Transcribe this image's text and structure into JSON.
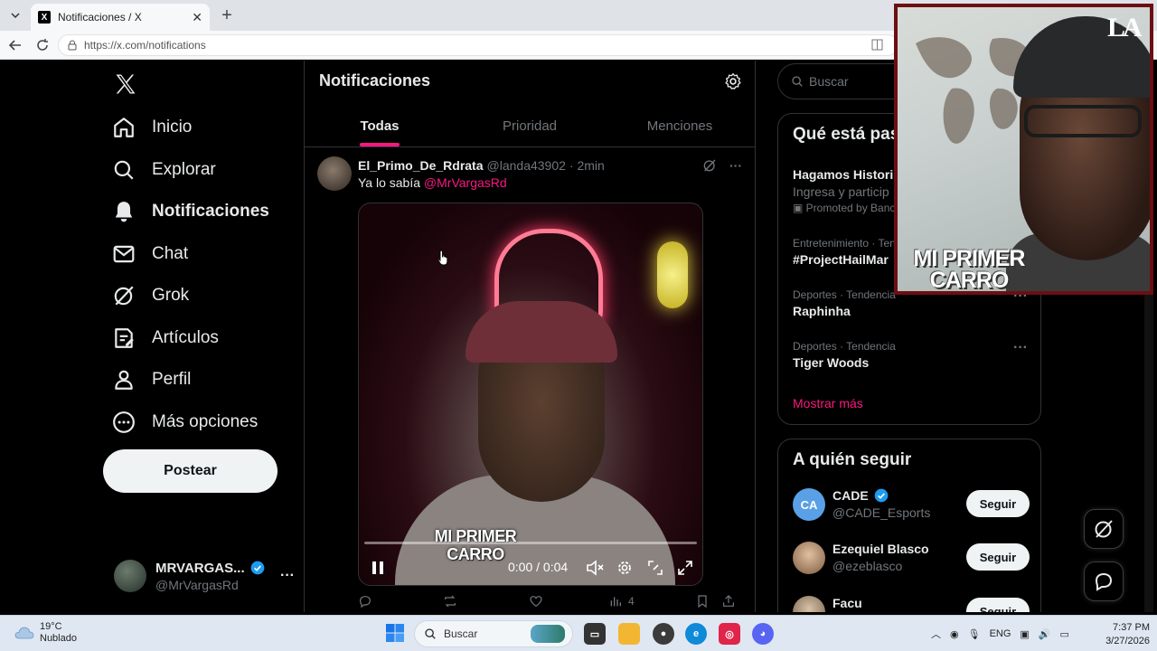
{
  "browser": {
    "tab_title": "Notificaciones / X",
    "url": "https://x.com/notifications"
  },
  "sidebar": {
    "items": [
      {
        "label": "Inicio",
        "icon": "home-icon",
        "active": false
      },
      {
        "label": "Explorar",
        "icon": "search-icon",
        "active": false
      },
      {
        "label": "Notificaciones",
        "icon": "bell-icon",
        "active": true
      },
      {
        "label": "Chat",
        "icon": "mail-icon",
        "active": false
      },
      {
        "label": "Grok",
        "icon": "grok-icon",
        "active": false
      },
      {
        "label": "Artículos",
        "icon": "article-icon",
        "active": false
      },
      {
        "label": "Perfil",
        "icon": "person-icon",
        "active": false
      },
      {
        "label": "Más opciones",
        "icon": "more-circle-icon",
        "active": false
      }
    ],
    "post_label": "Postear",
    "account": {
      "name": "MRVARGAS...",
      "handle": "@MrVargasRd"
    }
  },
  "main": {
    "title": "Notificaciones",
    "tabs": [
      "Todas",
      "Prioridad",
      "Menciones"
    ],
    "active_tab": "Todas",
    "tweet": {
      "name": "El_Primo_De_Rdrata",
      "handle": "@landa43902",
      "time": "· 2min",
      "text": "Ya lo sabía",
      "mention": "@MrVargasRd",
      "video": {
        "overlay_text_line1": "MI PRIMER",
        "overlay_text_line2": "CARRO",
        "time": "0:00 / 0:04",
        "progress": 0.0
      },
      "views": "4"
    }
  },
  "right": {
    "search_placeholder": "Buscar",
    "trends_title": "Qué está pasando",
    "trends": [
      {
        "context": "",
        "title": "Hagamos Histori",
        "sub": "Ingresa y particip",
        "promo": "Promoted by Banc"
      },
      {
        "context": "Entretenimiento · Ten",
        "title": "#ProjectHailMar"
      },
      {
        "context": "Deportes · Tendencia",
        "title": "Raphinha"
      },
      {
        "context": "Deportes · Tendencia",
        "title": "Tiger Woods"
      }
    ],
    "show_more": "Mostrar más",
    "follow_title": "A quién seguir",
    "follow": [
      {
        "name": "CADE",
        "handle": "@CADE_Esports",
        "verified": true,
        "button": "Seguir",
        "avatar_color": "#5aa0e6"
      },
      {
        "name": "Ezequiel Blasco",
        "handle": "@ezeblasco",
        "verified": false,
        "button": "Seguir",
        "avatar_color": "#c9a78a"
      },
      {
        "name": "Facu",
        "handle": "",
        "verified": false,
        "button": "Seguir",
        "avatar_color": "#b7a48f"
      }
    ]
  },
  "webcam": {
    "cap_logo": "LA",
    "logo_line1": "MI PRIMER",
    "logo_line2": "CARRO"
  },
  "taskbar": {
    "temperature": "19°C",
    "weather": "Nublado",
    "search_placeholder": "Buscar",
    "language": "ENG",
    "time": "7:37 PM",
    "date": "3/27/2026"
  },
  "colors": {
    "accent": "#f91880",
    "verified": "#1d9bf0",
    "background": "#000000"
  }
}
